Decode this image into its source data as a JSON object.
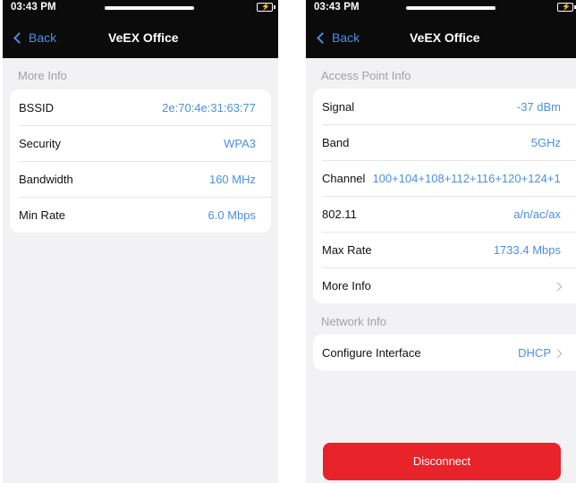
{
  "left": {
    "status": {
      "time": "03:43 PM"
    },
    "nav": {
      "back_label": "Back",
      "title": "VeEX Office"
    },
    "section_title": "More Info",
    "rows": [
      {
        "label": "BSSID",
        "value": "2e:70:4e:31:63:77"
      },
      {
        "label": "Security",
        "value": "WPA3"
      },
      {
        "label": "Bandwidth",
        "value": "160 MHz"
      },
      {
        "label": "Min Rate",
        "value": "6.0 Mbps"
      }
    ]
  },
  "right": {
    "status": {
      "time": "03:43 PM"
    },
    "nav": {
      "back_label": "Back",
      "title": "VeEX Office"
    },
    "access_point": {
      "section_title": "Access Point Info",
      "rows": [
        {
          "label": "Signal",
          "value": "-37 dBm"
        },
        {
          "label": "Band",
          "value": "5GHz"
        },
        {
          "label": "Channel",
          "value": "100+104+108+112+116+120+124+1"
        },
        {
          "label": "802.11",
          "value": "a/n/ac/ax"
        },
        {
          "label": "Max Rate",
          "value": "1733.4 Mbps"
        },
        {
          "label": "More Info",
          "value": ""
        }
      ]
    },
    "network": {
      "section_title": "Network Info",
      "rows": [
        {
          "label": "Configure Interface",
          "value": "DHCP"
        }
      ]
    },
    "disconnect_label": "Disconnect"
  },
  "colors": {
    "accent": "#4a90e2",
    "danger": "#e8232a",
    "topbar": "#0b0b0b",
    "background": "#f2f2f5"
  },
  "icons": {
    "back": "chevron-left-icon",
    "disclosure": "chevron-right-icon",
    "battery": "battery-charging-icon"
  }
}
